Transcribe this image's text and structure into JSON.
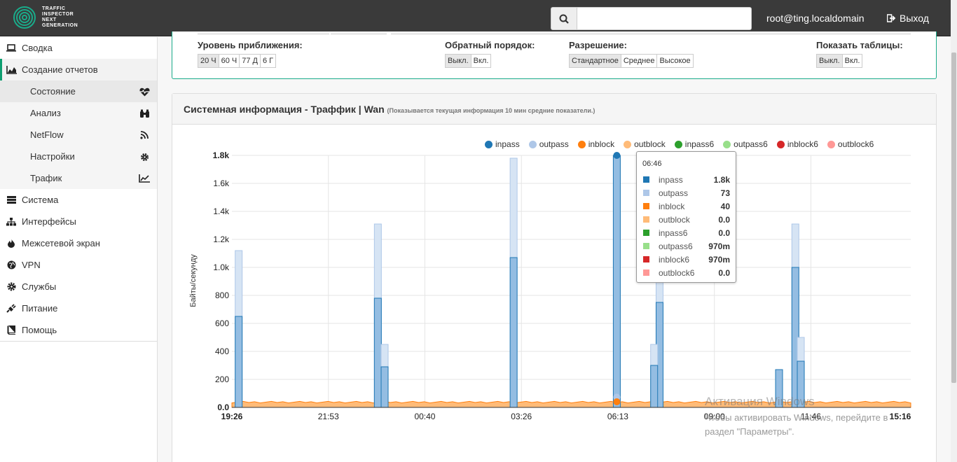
{
  "app": {
    "logo_lines": [
      "TRAFFIC",
      "INSPECTOR",
      "NEXT",
      "GENERATION"
    ],
    "user": "root@ting.localdomain",
    "logout_label": "Выход",
    "search_placeholder": ""
  },
  "sidebar": {
    "items": [
      {
        "label": "Сводка",
        "icon": "laptop-icon"
      },
      {
        "label": "Создание отчетов",
        "icon": "area-chart-icon"
      },
      {
        "label": "Система",
        "icon": "server-icon"
      },
      {
        "label": "Интерфейсы",
        "icon": "sitemap-icon"
      },
      {
        "label": "Межсетевой экран",
        "icon": "fire-icon"
      },
      {
        "label": "VPN",
        "icon": "globe-icon"
      },
      {
        "label": "Службы",
        "icon": "cog-icon"
      },
      {
        "label": "Питание",
        "icon": "plug-icon"
      },
      {
        "label": "Помощь",
        "icon": "book-icon"
      }
    ],
    "subitems": [
      {
        "label": "Состояние",
        "icon": "heartbeat-icon"
      },
      {
        "label": "Анализ",
        "icon": "binoculars-icon"
      },
      {
        "label": "NetFlow",
        "icon": "rss-icon"
      },
      {
        "label": "Настройки",
        "icon": "gear-icon"
      },
      {
        "label": "Трафик",
        "icon": "line-chart-icon"
      }
    ]
  },
  "options": {
    "zoom": {
      "label": "Уровень приближения:",
      "buttons": [
        "20 Ч",
        "60 Ч",
        "77 Д",
        "6 Г"
      ],
      "selected": "20 Ч"
    },
    "reverse": {
      "label": "Обратный порядок:",
      "buttons": [
        "Выкл.",
        "Вкл."
      ],
      "selected": "Выкл."
    },
    "resolution": {
      "label": "Разрешение:",
      "buttons": [
        "Стандартное",
        "Среднее",
        "Высокое"
      ],
      "selected": "Стандартное"
    },
    "tables": {
      "label": "Показать таблицы:",
      "buttons": [
        "Выкл.",
        "Вкл."
      ],
      "selected": "Выкл."
    }
  },
  "panel": {
    "title": "Системная информация - Траффик | Wan",
    "subtitle": "(Показывается текущая информация 10 мин средние показатели.)"
  },
  "chart_data": {
    "type": "area",
    "ylabel": "Байты/секунду",
    "ylim": [
      0,
      1800
    ],
    "y_ticks": [
      "0.0",
      "200",
      "400",
      "600",
      "800",
      "1.0k",
      "1.2k",
      "1.4k",
      "1.6k",
      "1.8k"
    ],
    "x_ticks": [
      "19:26",
      "21:53",
      "00:40",
      "03:26",
      "06:13",
      "09:00",
      "11:46",
      "15:16"
    ],
    "legend": [
      {
        "name": "inpass",
        "color": "#1f77b4"
      },
      {
        "name": "outpass",
        "color": "#aec7e8"
      },
      {
        "name": "inblock",
        "color": "#ff7f0e"
      },
      {
        "name": "outblock",
        "color": "#ffbb78"
      },
      {
        "name": "inpass6",
        "color": "#2ca02c"
      },
      {
        "name": "outpass6",
        "color": "#98df8a"
      },
      {
        "name": "inblock6",
        "color": "#d62728"
      },
      {
        "name": "outblock6",
        "color": "#ff9896"
      }
    ],
    "spikes": [
      {
        "t": 0.01,
        "inpass": 650,
        "outpass": 1120
      },
      {
        "t": 0.215,
        "inpass": 780,
        "outpass": 1310
      },
      {
        "t": 0.225,
        "inpass": 290,
        "outpass": 450
      },
      {
        "t": 0.415,
        "inpass": 1070,
        "outpass": 1780
      },
      {
        "t": 0.567,
        "inpass": 1800,
        "outpass": 1800
      },
      {
        "t": 0.63,
        "inpass": 750,
        "outpass": 1300
      },
      {
        "t": 0.622,
        "inpass": 300,
        "outpass": 450
      },
      {
        "t": 0.806,
        "inpass": 270,
        "outpass": 270
      },
      {
        "t": 0.83,
        "inpass": 1000,
        "outpass": 1310
      },
      {
        "t": 0.838,
        "inpass": 330,
        "outpass": 500
      }
    ],
    "baseline_outblock": 40,
    "tooltip": {
      "time": "06:46",
      "rows": [
        {
          "name": "inpass",
          "value": "1.8k",
          "color": "#1f77b4"
        },
        {
          "name": "outpass",
          "value": "73",
          "color": "#aec7e8"
        },
        {
          "name": "inblock",
          "value": "40",
          "color": "#ff7f0e"
        },
        {
          "name": "outblock",
          "value": "0.0",
          "color": "#ffbb78"
        },
        {
          "name": "inpass6",
          "value": "0.0",
          "color": "#2ca02c"
        },
        {
          "name": "outpass6",
          "value": "970m",
          "color": "#98df8a"
        },
        {
          "name": "inblock6",
          "value": "970m",
          "color": "#d62728"
        },
        {
          "name": "outblock6",
          "value": "0.0",
          "color": "#ff9896"
        }
      ]
    }
  },
  "watermark": {
    "line1": "Активация Windows",
    "line2": "Чтобы активировать Windows, перейдите в",
    "line3": "раздел \"Параметры\"."
  }
}
